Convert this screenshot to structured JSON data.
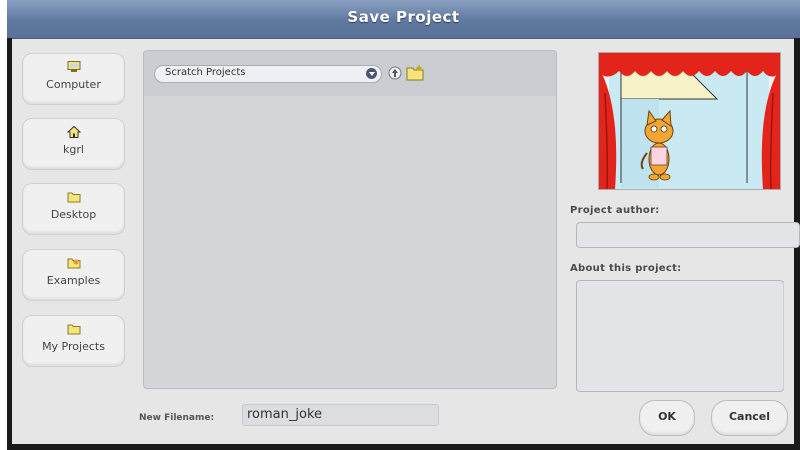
{
  "window": {
    "title": "Save Project"
  },
  "sidebar": {
    "items": [
      {
        "label": "Computer",
        "icon": "computer-icon"
      },
      {
        "label": "kgrl",
        "icon": "home-icon"
      },
      {
        "label": "Desktop",
        "icon": "folder-icon"
      },
      {
        "label": "Examples",
        "icon": "examples-folder-icon"
      },
      {
        "label": "My Projects",
        "icon": "folder-icon"
      }
    ]
  },
  "browser": {
    "path_selected": "Scratch Projects",
    "up_icon": "up-folder-icon",
    "new_folder_icon": "new-folder-icon"
  },
  "details": {
    "author_label": "Project author:",
    "author_value": "",
    "about_label": "About this project:",
    "about_value": ""
  },
  "filename": {
    "label": "New Filename:",
    "value": "roman_joke"
  },
  "buttons": {
    "ok": "OK",
    "cancel": "Cancel"
  },
  "colors": {
    "titlebar": "#5f789f",
    "curtain": "#e3241b",
    "folder": "#f5e47a"
  }
}
